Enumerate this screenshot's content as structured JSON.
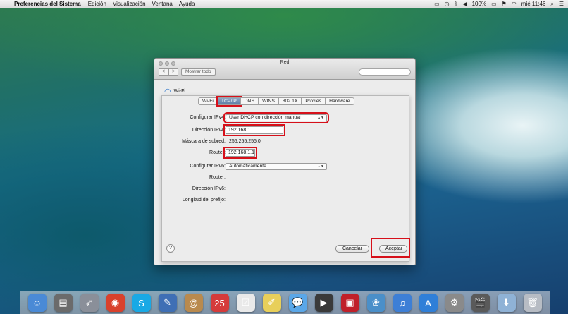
{
  "menubar": {
    "apple": "",
    "app_name": "Preferencias del Sistema",
    "menus": [
      "Edición",
      "Visualización",
      "Ventana",
      "Ayuda"
    ],
    "battery": "100%",
    "clock": "mié 11:46"
  },
  "window": {
    "title": "Red",
    "show_all": "Mostrar todo",
    "back": "<",
    "forward": ">",
    "wifi_label": "Wi-Fi"
  },
  "sheet": {
    "tabs": [
      {
        "label": "Wi-Fi"
      },
      {
        "label": "TCP/IP"
      },
      {
        "label": "DNS"
      },
      {
        "label": "WINS"
      },
      {
        "label": "802.1X"
      },
      {
        "label": "Proxies"
      },
      {
        "label": "Hardware"
      }
    ],
    "selected_tab": "TCP/IP",
    "configure_ipv4_label": "Configurar IPv4:",
    "configure_ipv4_value": "Usar DHCP con dirección manual",
    "ipv4_address_label": "Dirección IPv4:",
    "ipv4_address_value": "192.168.1.",
    "subnet_label": "Máscara de subred:",
    "subnet_value": "255.255.255.0",
    "router_label": "Router:",
    "router_value": "192.168.1.1",
    "configure_ipv6_label": "Configurar IPv6:",
    "configure_ipv6_value": "Automáticamente",
    "router6_label": "Router:",
    "ipv6_address_label": "Dirección IPv6:",
    "prefix_label": "Longitud del prefijo:",
    "help": "?",
    "cancel": "Cancelar",
    "accept": "Aceptar"
  },
  "dock": {
    "icons": [
      {
        "name": "finder-icon",
        "glyph": "☺",
        "color": "#4a8ad6"
      },
      {
        "name": "launchpad-icon",
        "glyph": "▤",
        "color": "#6b6b6b"
      },
      {
        "name": "rocket-icon",
        "glyph": "➶",
        "color": "#8a8f99"
      },
      {
        "name": "chrome-icon",
        "glyph": "◉",
        "color": "#d9412c"
      },
      {
        "name": "skype-icon",
        "glyph": "S",
        "color": "#19a9e5"
      },
      {
        "name": "preview-icon",
        "glyph": "✎",
        "color": "#3f6fb5"
      },
      {
        "name": "contacts-icon",
        "glyph": "@",
        "color": "#b98a4e"
      },
      {
        "name": "calendar-icon",
        "glyph": "25",
        "color": "#d53b3b"
      },
      {
        "name": "reminders-icon",
        "glyph": "☑",
        "color": "#e9e9e9"
      },
      {
        "name": "notes-icon",
        "glyph": "✐",
        "color": "#e8cf5a"
      },
      {
        "name": "messages-icon",
        "glyph": "💬",
        "color": "#5aa7e8"
      },
      {
        "name": "facetime-icon",
        "glyph": "▶",
        "color": "#3a3a3a"
      },
      {
        "name": "photo-booth-icon",
        "glyph": "▣",
        "color": "#c0202a"
      },
      {
        "name": "iphoto-icon",
        "glyph": "❀",
        "color": "#4a8fc9"
      },
      {
        "name": "itunes-icon",
        "glyph": "♫",
        "color": "#3d7fd6"
      },
      {
        "name": "app-store-icon",
        "glyph": "A",
        "color": "#2f7fd8"
      },
      {
        "name": "system-preferences-icon",
        "glyph": "⚙",
        "color": "#8a8a8a"
      },
      {
        "name": "movie-icon",
        "glyph": "🎬",
        "color": "#5a5a5a"
      },
      {
        "name": "downloads-folder-icon",
        "glyph": "⬇",
        "color": "#8fb2d6"
      },
      {
        "name": "trash-icon",
        "glyph": "🗑",
        "color": "#b7bcc4"
      }
    ]
  }
}
